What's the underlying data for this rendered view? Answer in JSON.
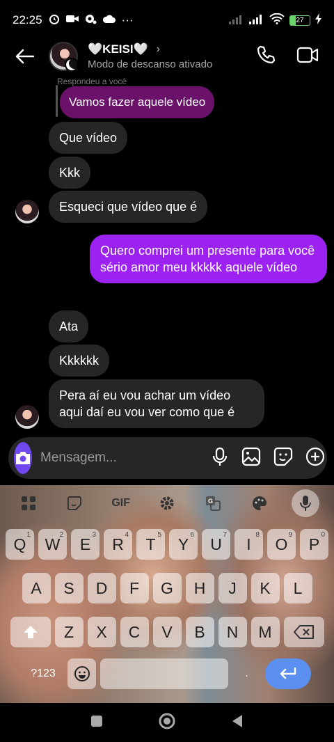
{
  "status_bar": {
    "time": "22:25",
    "battery": "27",
    "more": "···"
  },
  "header": {
    "contact_name": "🤍KEISI🤍",
    "chevron": "›",
    "status": "Modo de descanso ativado"
  },
  "messages": {
    "reply_ref_label": "Respondeu a você",
    "reply_text": "Vamos fazer aquele vídeo",
    "items": [
      {
        "text": "Que vídeo",
        "direction": "in"
      },
      {
        "text": "Kkk",
        "direction": "in"
      },
      {
        "text": "Esqueci que  vídeo que é",
        "direction": "in"
      },
      {
        "text": "Quero comprei um presente para você sério amor meu kkkkk aquele vídeo",
        "direction": "out"
      },
      {
        "text": "Ata",
        "direction": "in"
      },
      {
        "text": "Kkkkkk",
        "direction": "in"
      },
      {
        "text": "Pera aí eu vou achar um vídeo aqui daí eu vou ver como que é",
        "direction": "in"
      }
    ]
  },
  "composer": {
    "placeholder": "Mensagem..."
  },
  "keyboard": {
    "toolbar": {
      "gif": "GIF"
    },
    "row1": [
      "Q",
      "W",
      "E",
      "R",
      "T",
      "Y",
      "U",
      "I",
      "O",
      "P"
    ],
    "row1_hints": [
      "1",
      "2",
      "3",
      "4",
      "5",
      "6",
      "7",
      "8",
      "9",
      "0"
    ],
    "row2": [
      "A",
      "S",
      "D",
      "F",
      "G",
      "H",
      "J",
      "K",
      "L"
    ],
    "row3": [
      "Z",
      "X",
      "C",
      "V",
      "B",
      "N",
      "M"
    ],
    "symbols": "?123",
    "period": "."
  },
  "colors": {
    "outgoing": "#9b22f0",
    "incoming": "#262626",
    "reply": "#6a126a",
    "camera": "#6f48f0",
    "enter": "#5b8ff0"
  }
}
